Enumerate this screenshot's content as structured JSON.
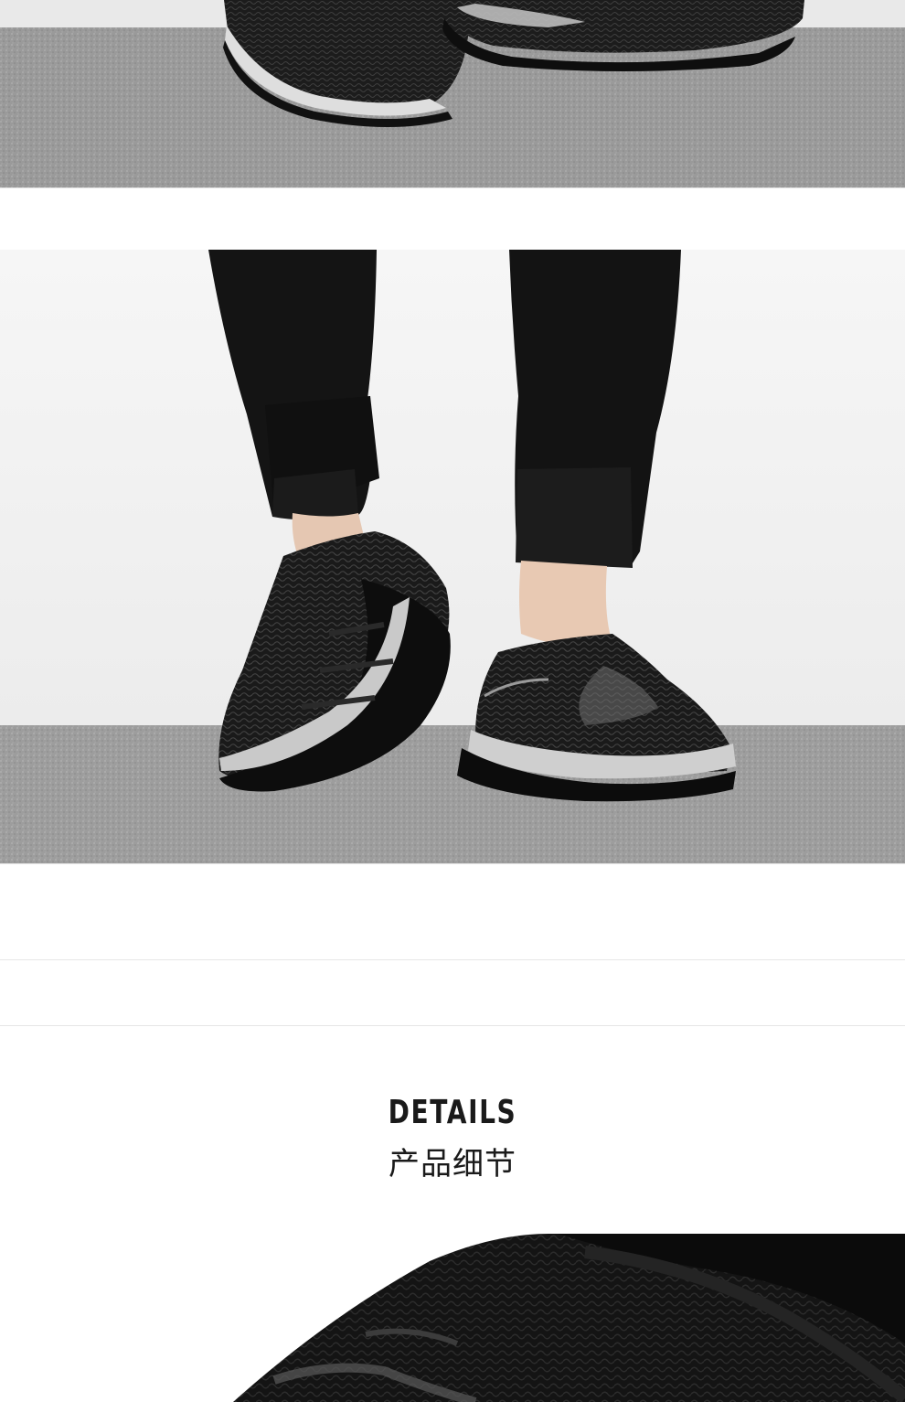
{
  "details": {
    "title": "DETAILS",
    "subtitle": "产品细节"
  },
  "colors": {
    "background": "#ffffff",
    "carpet": "#9c9c9c",
    "wall": "#f3f3f3",
    "shoe": "#141414",
    "accent_silver": "#c8c8c8"
  }
}
